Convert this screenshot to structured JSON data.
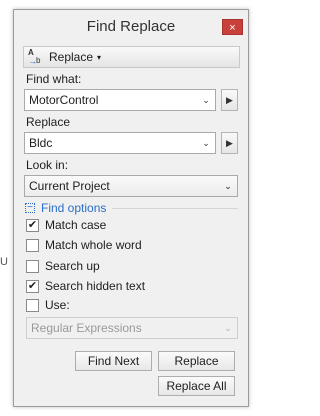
{
  "stray_glyph": "U",
  "window": {
    "title": "Find Replace",
    "close_glyph": "×"
  },
  "mode_bar": {
    "label": "Replace",
    "icon": "find-replace-icon",
    "icon_text": {
      "a": "A",
      "b": "b",
      "arrow": "→"
    },
    "caret": "▾"
  },
  "find_what": {
    "label": "Find what:",
    "value": "MotorControl"
  },
  "replace": {
    "label": "Replace",
    "value": "Bldc"
  },
  "look_in": {
    "label": "Look in:",
    "value": "Current Project"
  },
  "glyphs": {
    "chevron": "⌄",
    "arrow_right": "▶",
    "check": "✔",
    "collapse": "−"
  },
  "find_options": {
    "header": "Find options",
    "checkboxes": [
      {
        "label": "Match case",
        "checked": true
      },
      {
        "label": "Match whole word",
        "checked": false
      },
      {
        "label": "Search up",
        "checked": false
      },
      {
        "label": "Search hidden text",
        "checked": true
      },
      {
        "label": "Use:",
        "checked": false
      }
    ],
    "use_option": "Regular Expressions"
  },
  "buttons": {
    "find_next": "Find Next",
    "replace": "Replace",
    "replace_all": "Replace All"
  },
  "colors": {
    "accent": "#2b6ec9",
    "close": "#c7413a"
  }
}
